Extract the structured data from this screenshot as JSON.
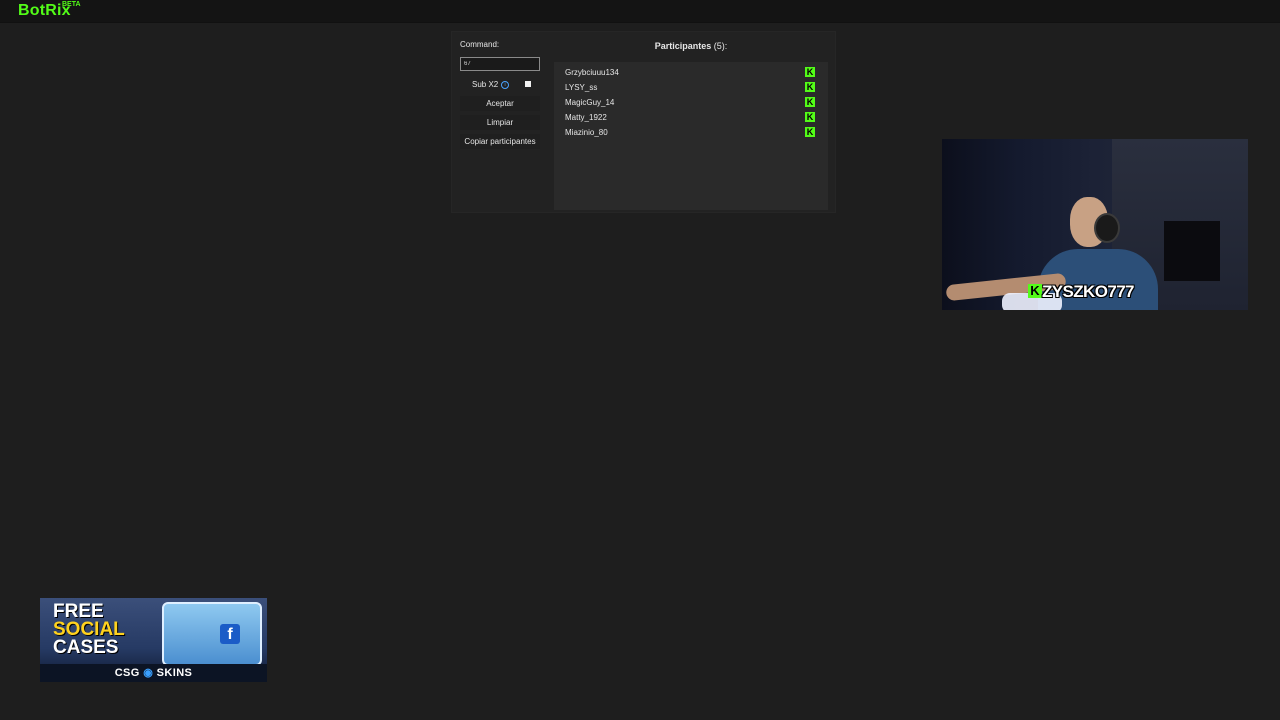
{
  "app": {
    "logo": "BotRix",
    "logo_badge": "BETA"
  },
  "giveaway": {
    "command_label": "Command:",
    "command_value": "67",
    "sub_label": "Sub X2",
    "buttons": {
      "accept": "Aceptar",
      "clear": "Limpiar",
      "copy": "Copiar participantes"
    },
    "participants_title": "Participantes",
    "participants_count": "(5):",
    "participants": [
      {
        "name": "Grzybciuuu134",
        "platform_icon": "kick-icon"
      },
      {
        "name": "LYSY_ss",
        "platform_icon": "kick-icon"
      },
      {
        "name": "MagicGuy_14",
        "platform_icon": "kick-icon"
      },
      {
        "name": "Matty_1922",
        "platform_icon": "kick-icon"
      },
      {
        "name": "Miazinio_80",
        "platform_icon": "kick-icon"
      }
    ]
  },
  "webcam": {
    "streamer_name": "ZYSZKO777"
  },
  "ad": {
    "line1": "FREE",
    "line2": "SOCIAL",
    "line3": "CASES",
    "brand_left": "CSG",
    "brand_right": "SKINS"
  },
  "colors": {
    "kick_green": "#53fc18",
    "background": "#1e1e1e",
    "panel": "#222222",
    "info_blue": "#4aa3ff"
  }
}
